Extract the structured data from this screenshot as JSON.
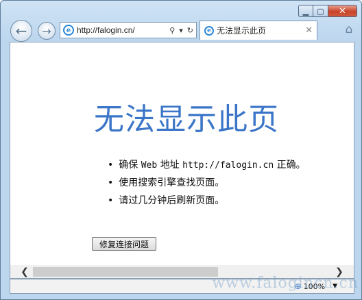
{
  "window": {
    "minimize": "▁",
    "maximize": "▢",
    "close": "✕"
  },
  "nav": {
    "back": "←",
    "forward": "→"
  },
  "address": {
    "ie_glyph": "e",
    "url": "http://falogin.cn/",
    "search_glyph": "⚲",
    "dropdown_glyph": "▾",
    "refresh_glyph": "↻"
  },
  "tab": {
    "ie_glyph": "e",
    "label": "无法显示此页",
    "close": "✕"
  },
  "home_glyph": "⌂",
  "page": {
    "title": "无法显示此页",
    "bullets": {
      "b1_pre": "确保 ",
      "b1_web": "Web",
      "b1_mid": " 地址 ",
      "b1_url": "http://falogin.cn",
      "b1_post": " 正确。",
      "b2": "使用搜索引擎查找页面。",
      "b3": "请过几分钟后刷新页面。"
    },
    "fix_button": "修复连接问题"
  },
  "scrollbar": {
    "left": "❮",
    "right": "❯"
  },
  "status": {
    "zoom_icon": "⊕",
    "zoom": "100%",
    "zoom_caret": "▼"
  },
  "watermark": "www.falogincn.cn"
}
